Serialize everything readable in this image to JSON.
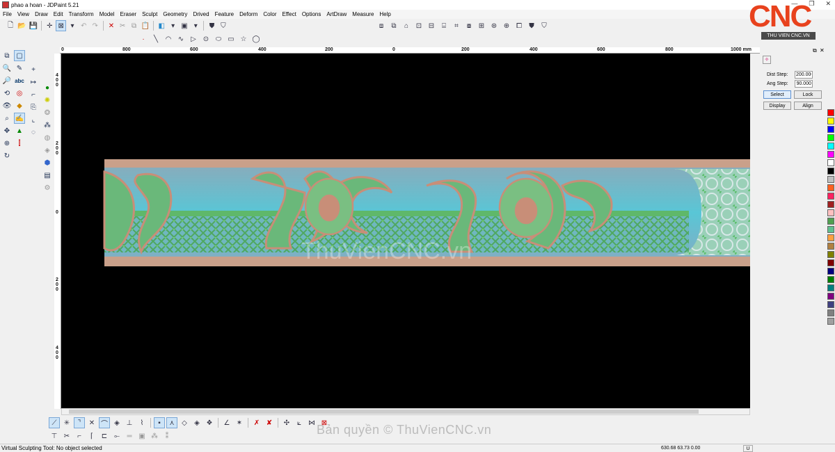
{
  "window": {
    "title": "phao a hoan - JDPaint 5.21",
    "controls": [
      "—",
      "❐",
      "✕"
    ]
  },
  "menu": [
    "File",
    "View",
    "Draw",
    "Edit",
    "Transform",
    "Model",
    "Eraser",
    "Sculpt",
    "Geometry",
    "Drived",
    "Feature",
    "Deform",
    "Color",
    "Effect",
    "Options",
    "ArtDraw",
    "Measure",
    "Help"
  ],
  "logo": {
    "text": "CNC",
    "subtitle": "THU VIEN CNC.VN"
  },
  "ruler": {
    "top_labels": [
      "0",
      "800",
      "600",
      "400",
      "200",
      "0",
      "200",
      "400",
      "600",
      "800",
      "1000 mm"
    ],
    "left_labels": [
      [
        "4",
        "0",
        "0"
      ],
      [
        "2",
        "0",
        "0"
      ],
      [
        "0"
      ],
      [
        "2",
        "0",
        "0"
      ],
      [
        "4",
        "0",
        "0"
      ]
    ]
  },
  "panel": {
    "dist_step_label": "Dist Step:",
    "dist_step_value": "200.000",
    "ang_step_label": "Ang Step:",
    "ang_step_value": "90.000",
    "buttons": {
      "select": "Select",
      "lock": "Lock",
      "display": "Display",
      "align": "Align"
    }
  },
  "palette": [
    "#ff0000",
    "#ffff00",
    "#0000ff",
    "#00ff00",
    "#00ffff",
    "#ff00ff",
    "#ffffff",
    "#000000",
    "#c0c0c0",
    "#ff6020",
    "#ff2060",
    "#a02020",
    "#ffc0c0",
    "#50a050",
    "#60c090",
    "#ffa040",
    "#b08040",
    "#808000",
    "#800000",
    "#000080",
    "#008000",
    "#008080",
    "#800080",
    "#404080",
    "#808080",
    "#a0a0a0"
  ],
  "canvas": {
    "watermark": "ThuVienCNC.vn"
  },
  "copyright": "Bản quyền © ThuVienCNC.vn",
  "status": {
    "text": "Virtual Sculpting Tool: No object selected",
    "coords": "630.68 63.73 0.00",
    "mode": "U"
  }
}
